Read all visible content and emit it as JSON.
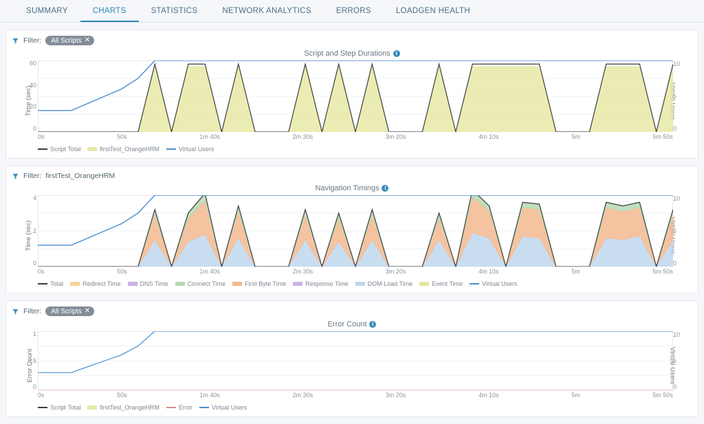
{
  "tabs": {
    "summary": "SUMMARY",
    "charts": "CHARTS",
    "statistics": "STATISTICS",
    "network_analytics": "NETWORK ANALYTICS",
    "errors": "ERRORS",
    "loadgen_health": "LOADGEN HEALTH",
    "active": "charts"
  },
  "labels": {
    "filter": "Filter:",
    "all_scripts": "All Scripts",
    "script_name": "firstTest_OrangeHRM",
    "virtual_users_axis": "Virtual Users",
    "time_sec_axis": "Time (sec)",
    "error_count_axis": "Error Count"
  },
  "panels": {
    "durations": {
      "title": "Script and Step Durations"
    },
    "nav_timings": {
      "title": "Navigation Timings"
    },
    "error_count": {
      "title": "Error Count"
    }
  },
  "legends": {
    "durations": [
      "Script Total",
      "firstTest_OrangeHRM",
      "Virtual Users"
    ],
    "nav_timings": [
      "Total",
      "Redirect Time",
      "DNS Time",
      "Connect Time",
      "First Byte Time",
      "Response Time",
      "DOM Load Time",
      "Event Time",
      "Virtual Users"
    ],
    "error_count": [
      "Script Total",
      "firstTest_OrangeHRM",
      "Error",
      "Virtual Users"
    ]
  },
  "colors": {
    "script_total": "#3a3a3a",
    "virtual_users": "#4a8fd6",
    "orange_hrm_area": "#e7e9a6",
    "orange_hrm_edge": "#cfd26b",
    "total_line": "#3a3a3a",
    "redirect": "#f5d49b",
    "dns": "#c8b3de",
    "connect": "#b5d9b2",
    "first_byte": "#f3b98e",
    "response": "#cbb6e3",
    "dom_load": "#bfd7ee",
    "event_time": "#e3e6a4",
    "error": "#d98b8b"
  },
  "x_ticks": [
    "0s",
    "50s",
    "1m 40s",
    "2m 30s",
    "3m 20s",
    "4m 10s",
    "5m",
    "5m 50s"
  ],
  "chart_data": [
    {
      "id": "script_step_durations",
      "type": "line+area",
      "title": "Script and Step Durations",
      "xlabel": "",
      "ylabel": "Time (sec)",
      "y2label": "Virtual Users",
      "ylim": [
        0,
        60
      ],
      "y2lim": [
        0,
        10
      ],
      "x": [
        0,
        10,
        20,
        30,
        40,
        50,
        60,
        70,
        80,
        90,
        100,
        110,
        120,
        130,
        140,
        150,
        160,
        170,
        180,
        190,
        200,
        210,
        220,
        230,
        240,
        250,
        260,
        270,
        280,
        290,
        300,
        310,
        320,
        330,
        340,
        350,
        360,
        370,
        380
      ],
      "y_ticks": [
        0,
        20,
        40,
        60
      ],
      "y2_ticks": [
        0,
        5,
        10
      ],
      "series": [
        {
          "name": "Script Total",
          "axis": "y",
          "type": "line",
          "color": "#3a3a3a",
          "values": [
            0,
            0,
            0,
            0,
            0,
            0,
            0,
            57,
            0,
            57,
            57,
            0,
            57,
            0,
            0,
            0,
            57,
            0,
            57,
            0,
            57,
            0,
            0,
            0,
            57,
            0,
            57,
            57,
            57,
            57,
            57,
            0,
            0,
            0,
            57,
            57,
            57,
            0,
            57
          ]
        },
        {
          "name": "firstTest_OrangeHRM",
          "axis": "y",
          "type": "area",
          "color": "#e7e9a6",
          "values": [
            0,
            0,
            0,
            0,
            0,
            0,
            0,
            55,
            0,
            55,
            55,
            0,
            55,
            0,
            0,
            0,
            55,
            0,
            55,
            0,
            55,
            0,
            0,
            0,
            55,
            0,
            55,
            55,
            55,
            55,
            55,
            0,
            0,
            0,
            55,
            55,
            55,
            0,
            55
          ]
        },
        {
          "name": "Virtual Users",
          "axis": "y2",
          "type": "line",
          "color": "#4a8fd6",
          "values": [
            3,
            3,
            3,
            4,
            5,
            6,
            7.5,
            10,
            10,
            10,
            10,
            10,
            10,
            10,
            10,
            10,
            10,
            10,
            10,
            10,
            10,
            10,
            10,
            10,
            10,
            10,
            10,
            10,
            10,
            10,
            10,
            10,
            10,
            10,
            10,
            10,
            10,
            10,
            10
          ]
        }
      ]
    },
    {
      "id": "navigation_timings",
      "type": "stacked-area",
      "title": "Navigation Timings",
      "xlabel": "",
      "ylabel": "Time (sec)",
      "y2label": "Virtual Users",
      "ylim": [
        0,
        4
      ],
      "y2lim": [
        0,
        10
      ],
      "x": [
        0,
        10,
        20,
        30,
        40,
        50,
        60,
        70,
        80,
        90,
        100,
        110,
        120,
        130,
        140,
        150,
        160,
        170,
        180,
        190,
        200,
        210,
        220,
        230,
        240,
        250,
        260,
        270,
        280,
        290,
        300,
        310,
        320,
        330,
        340,
        350,
        360,
        370,
        380
      ],
      "y_ticks": [
        0,
        2,
        4
      ],
      "y2_ticks": [
        0,
        5,
        10
      ],
      "series": [
        {
          "name": "Total",
          "axis": "y",
          "type": "line",
          "color": "#3a3a3a",
          "values": [
            0,
            0,
            0,
            0,
            0,
            0,
            0,
            3.2,
            0,
            3.0,
            4.1,
            0,
            3.4,
            0,
            0,
            0,
            3.2,
            0,
            3.0,
            0,
            3.2,
            0,
            0,
            0,
            3.0,
            0,
            4.3,
            3.4,
            0,
            3.6,
            3.5,
            0,
            0,
            0,
            3.6,
            3.4,
            3.6,
            0,
            3.2
          ]
        },
        {
          "name": "DOM Load Time",
          "axis": "y",
          "type": "area",
          "color": "#bfd7ee",
          "values": [
            0,
            0,
            0,
            0,
            0,
            0,
            0,
            1.5,
            0,
            1.4,
            1.8,
            0,
            1.6,
            0,
            0,
            0,
            1.5,
            0,
            1.4,
            0,
            1.5,
            0,
            0,
            0,
            1.5,
            0,
            1.9,
            1.6,
            0,
            1.7,
            1.6,
            0,
            0,
            0,
            1.6,
            1.5,
            1.7,
            0,
            1.5
          ]
        },
        {
          "name": "First Byte Time",
          "axis": "y",
          "type": "area",
          "color": "#f3b98e",
          "values": [
            0,
            0,
            0,
            0,
            0,
            0,
            0,
            1.4,
            0,
            1.3,
            1.9,
            0,
            1.5,
            0,
            0,
            0,
            1.4,
            0,
            1.3,
            0,
            1.4,
            0,
            0,
            0,
            1.2,
            0,
            2.0,
            1.5,
            0,
            1.6,
            1.6,
            0,
            0,
            0,
            1.7,
            1.6,
            1.6,
            0,
            1.4
          ]
        },
        {
          "name": "Connect Time",
          "axis": "y",
          "type": "area",
          "color": "#b5d9b2",
          "values": [
            0,
            0,
            0,
            0,
            0,
            0,
            0,
            0.3,
            0,
            0.3,
            0.4,
            0,
            0.3,
            0,
            0,
            0,
            0.3,
            0,
            0.3,
            0,
            0.3,
            0,
            0,
            0,
            0.3,
            0,
            0.4,
            0.3,
            0,
            0.3,
            0.3,
            0,
            0,
            0,
            0.3,
            0.3,
            0.3,
            0,
            0.3
          ]
        },
        {
          "name": "Virtual Users",
          "axis": "y2",
          "type": "line",
          "color": "#4a8fd6",
          "values": [
            3,
            3,
            3,
            4,
            5,
            6,
            7.5,
            10,
            10,
            10,
            10,
            10,
            10,
            10,
            10,
            10,
            10,
            10,
            10,
            10,
            10,
            10,
            10,
            10,
            10,
            10,
            10,
            10,
            10,
            10,
            10,
            10,
            10,
            10,
            10,
            10,
            10,
            10,
            10
          ]
        }
      ]
    },
    {
      "id": "error_count",
      "type": "line",
      "title": "Error Count",
      "xlabel": "",
      "ylabel": "Error Count",
      "y2label": "Virtual Users",
      "ylim": [
        0,
        1
      ],
      "y2lim": [
        0,
        10
      ],
      "x": [
        0,
        10,
        20,
        30,
        40,
        50,
        60,
        70,
        80,
        90,
        100,
        110,
        120,
        130,
        140,
        150,
        160,
        170,
        180,
        190,
        200,
        210,
        220,
        230,
        240,
        250,
        260,
        270,
        280,
        290,
        300,
        310,
        320,
        330,
        340,
        350,
        360,
        370,
        380
      ],
      "y_ticks": [
        0,
        0.5,
        1
      ],
      "y2_ticks": [
        0,
        5,
        10
      ],
      "series": [
        {
          "name": "Script Total",
          "axis": "y",
          "type": "line",
          "color": "#3a3a3a",
          "values": [
            0,
            0,
            0,
            0,
            0,
            0,
            0,
            0,
            0,
            0,
            0,
            0,
            0,
            0,
            0,
            0,
            0,
            0,
            0,
            0,
            0,
            0,
            0,
            0,
            0,
            0,
            0,
            0,
            0,
            0,
            0,
            0,
            0,
            0,
            0,
            0,
            0,
            0,
            0
          ]
        },
        {
          "name": "firstTest_OrangeHRM",
          "axis": "y",
          "type": "area",
          "color": "#e7e9a6",
          "values": [
            0,
            0,
            0,
            0,
            0,
            0,
            0,
            0,
            0,
            0,
            0,
            0,
            0,
            0,
            0,
            0,
            0,
            0,
            0,
            0,
            0,
            0,
            0,
            0,
            0,
            0,
            0,
            0,
            0,
            0,
            0,
            0,
            0,
            0,
            0,
            0,
            0,
            0,
            0
          ]
        },
        {
          "name": "Error",
          "axis": "y",
          "type": "line",
          "color": "#d98b8b",
          "values": [
            0,
            0,
            0,
            0,
            0,
            0,
            0,
            0,
            0,
            0,
            0,
            0,
            0,
            0,
            0,
            0,
            0,
            0,
            0,
            0,
            0,
            0,
            0,
            0,
            0,
            0,
            0,
            0,
            0,
            0,
            0,
            0,
            0,
            0,
            0,
            0,
            0,
            0,
            0
          ]
        },
        {
          "name": "Virtual Users",
          "axis": "y2",
          "type": "line",
          "color": "#4a8fd6",
          "values": [
            3,
            3,
            3,
            4,
            5,
            6,
            7.5,
            10,
            10,
            10,
            10,
            10,
            10,
            10,
            10,
            10,
            10,
            10,
            10,
            10,
            10,
            10,
            10,
            10,
            10,
            10,
            10,
            10,
            10,
            10,
            10,
            10,
            10,
            10,
            10,
            10,
            10,
            10,
            10
          ]
        }
      ]
    }
  ]
}
